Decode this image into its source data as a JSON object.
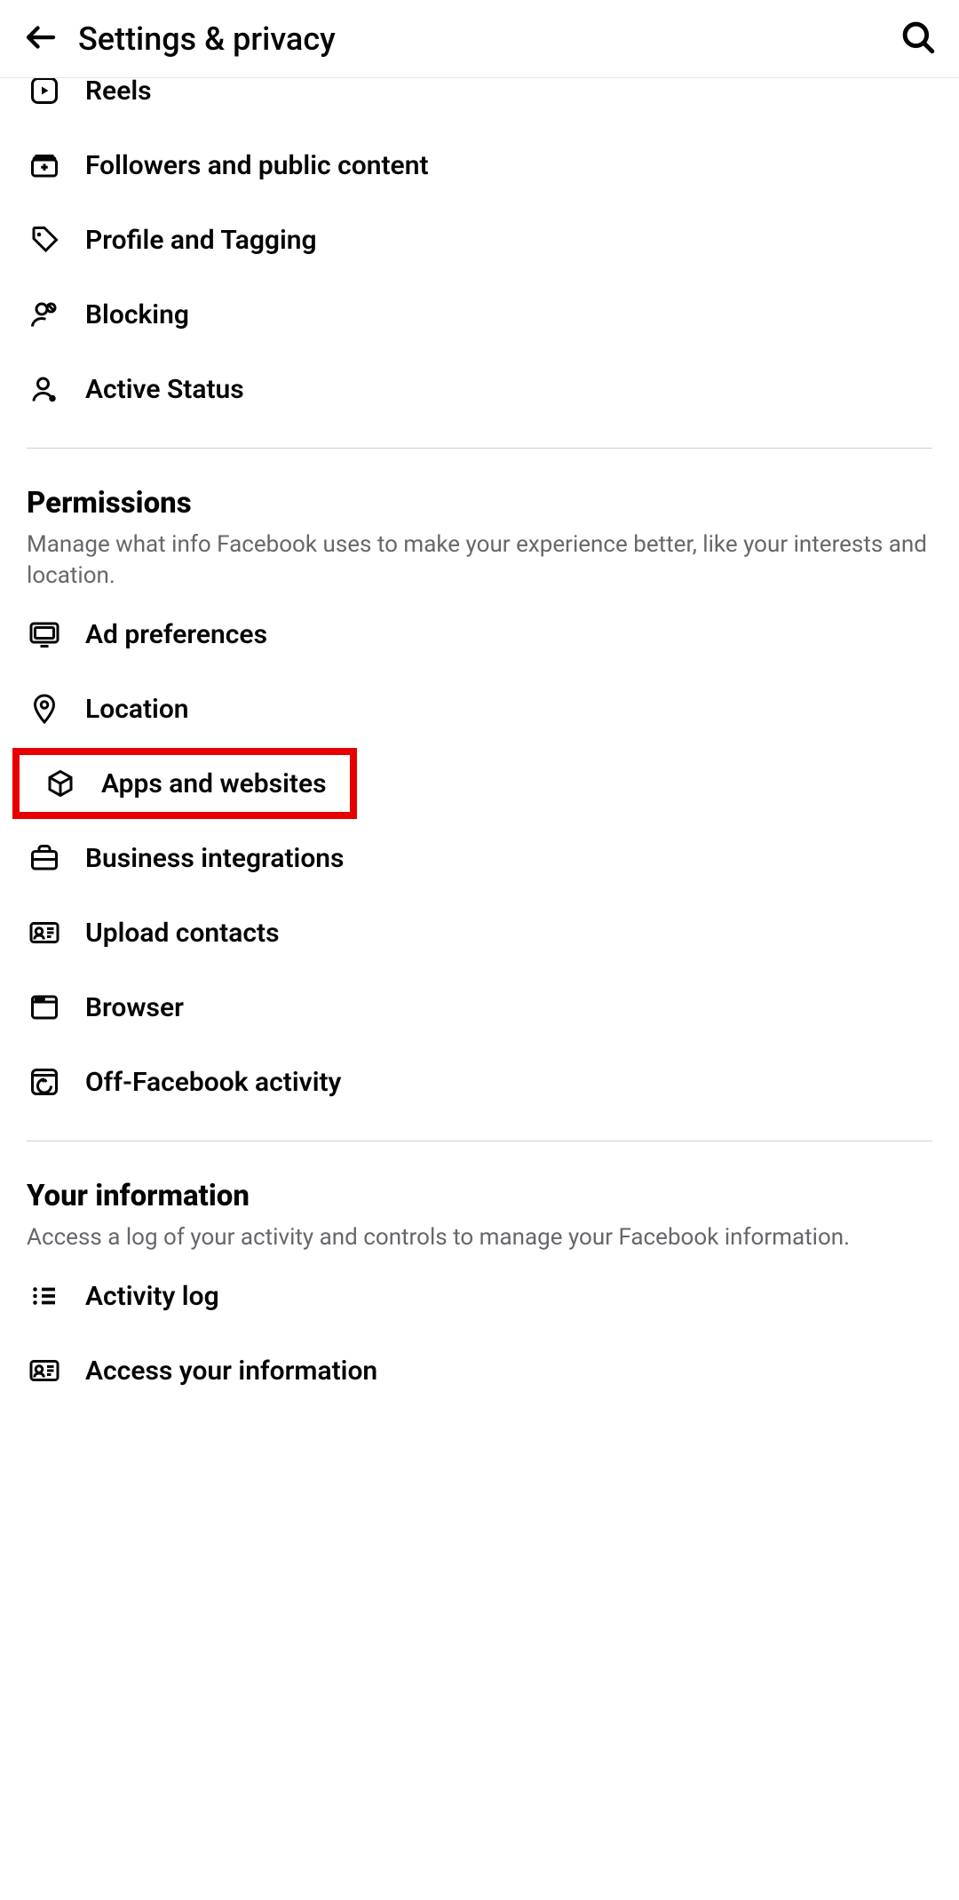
{
  "header": {
    "title": "Settings & privacy"
  },
  "section_audience": {
    "items": [
      {
        "label": "Reels",
        "icon": "reels"
      },
      {
        "label": "Followers and public content",
        "icon": "archive-plus"
      },
      {
        "label": "Profile and Tagging",
        "icon": "tag"
      },
      {
        "label": "Blocking",
        "icon": "block-person"
      },
      {
        "label": "Active Status",
        "icon": "active-person"
      }
    ]
  },
  "section_permissions": {
    "title": "Permissions",
    "description": "Manage what info Facebook uses to make your experience better, like your interests and location.",
    "items": [
      {
        "label": "Ad preferences",
        "icon": "ad"
      },
      {
        "label": "Location",
        "icon": "pin"
      },
      {
        "label": "Apps and websites",
        "icon": "cube",
        "highlighted": true
      },
      {
        "label": "Business integrations",
        "icon": "briefcase"
      },
      {
        "label": "Upload contacts",
        "icon": "contact-card"
      },
      {
        "label": "Browser",
        "icon": "browser"
      },
      {
        "label": "Off-Facebook activity",
        "icon": "activity-square"
      }
    ]
  },
  "section_your_info": {
    "title": "Your information",
    "description": "Access a log of your activity and controls to manage your Facebook information.",
    "items": [
      {
        "label": "Activity log",
        "icon": "list"
      },
      {
        "label": "Access your information",
        "icon": "id-card"
      }
    ]
  }
}
